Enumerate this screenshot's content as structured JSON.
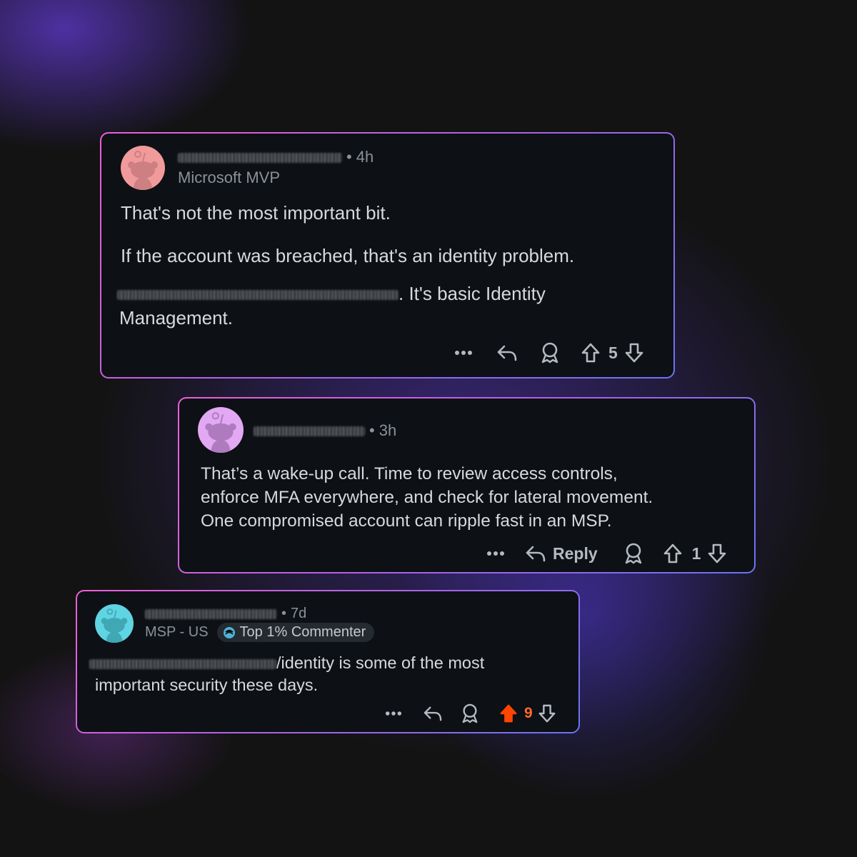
{
  "comments": [
    {
      "time": "4h",
      "flair": "Microsoft MVP",
      "paragraphs": [
        "That's not the most important bit.",
        "If the account was breached, that's an identity problem."
      ],
      "tail": ". It's basic Identity",
      "tail2": "Management.",
      "vote_count": "5",
      "avatar_color": "#f19a9c"
    },
    {
      "time": "3h",
      "lines": [
        "That’s a wake-up call. Time to review access controls,",
        "enforce MFA everywhere, and check for lateral movement.",
        "One compromised account can ripple fast in an MSP."
      ],
      "reply_label": "Reply",
      "vote_count": "1",
      "avatar_color": "#e3a8f3"
    },
    {
      "time": "7d",
      "flair": "MSP - US",
      "badge_label": "Top 1% Commenter",
      "line1_tail": "/identity is some of the most",
      "line2": "important security these days.",
      "vote_count": "9",
      "avatar_color": "#5fd4e2",
      "upvoted_color": "#ff4500"
    }
  ],
  "icons": [
    "more-icon",
    "reply-icon",
    "award-icon",
    "upvote-icon",
    "downvote-icon",
    "top-commenter-icon"
  ]
}
